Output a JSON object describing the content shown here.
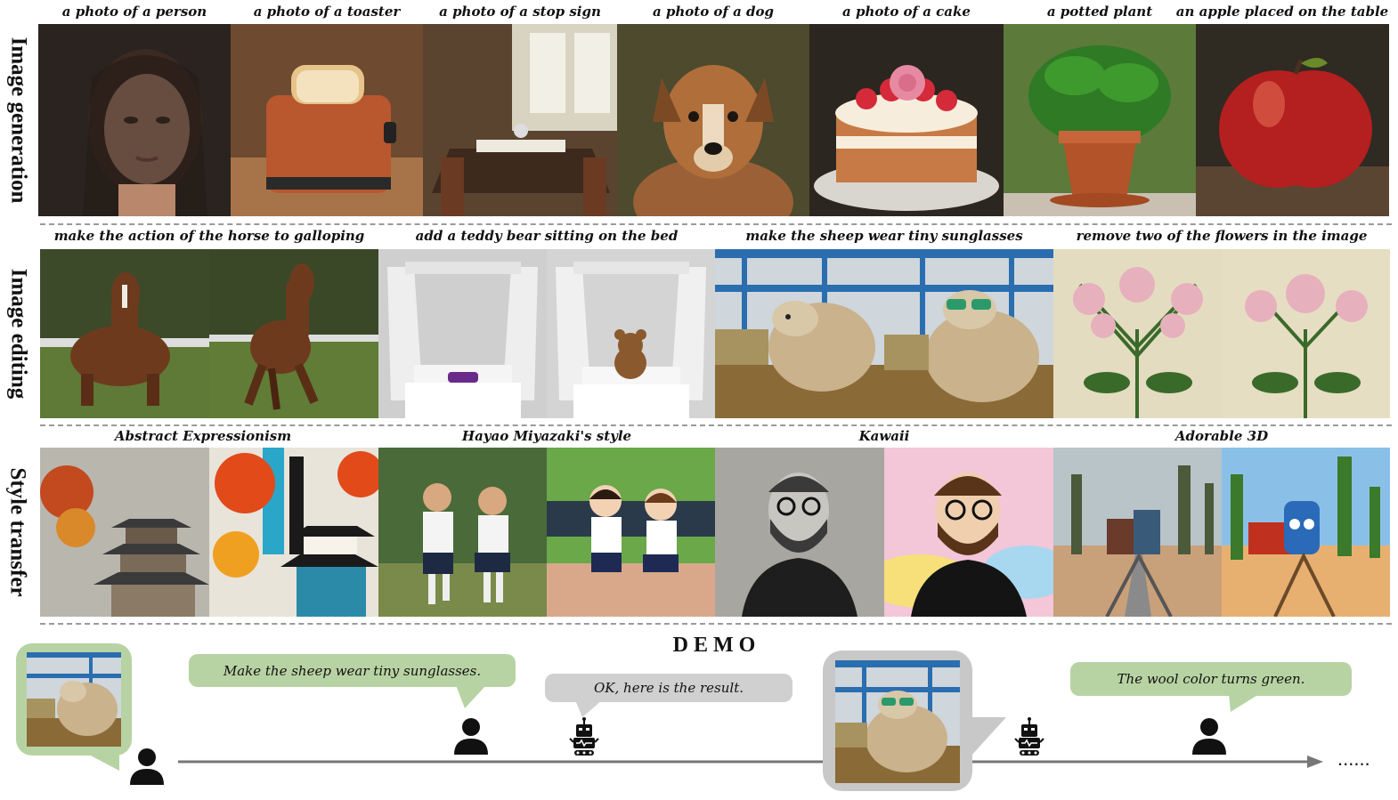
{
  "rows": {
    "generation_label": "Image generation",
    "editing_label": "Image editing",
    "style_label": "Style transfer"
  },
  "generation": {
    "captions": [
      "a photo of a person",
      "a photo of a toaster",
      "a photo of a stop sign",
      "a photo of a dog",
      "a photo of a cake",
      "a potted plant",
      "an apple placed on the table"
    ]
  },
  "editing": {
    "captions": [
      "make the action of the horse to galloping",
      "add a teddy bear sitting on the bed",
      "make the sheep wear tiny sunglasses",
      "remove two of the flowers in the image"
    ]
  },
  "style": {
    "captions": [
      "Abstract Expressionism",
      "Hayao Miyazaki's style",
      "Kawaii",
      "Adorable 3D"
    ]
  },
  "demo": {
    "title": "DEMO",
    "user_msg_1": "Make the sheep wear tiny sunglasses.",
    "bot_msg_1": "OK, here is the result.",
    "user_msg_2": "The wool color turns green.",
    "ellipsis": "......"
  },
  "colors": {
    "green_bubble": "#b8d3a3",
    "gray_bubble": "#d0d0d0",
    "timeline": "#777777"
  },
  "icons": {
    "user": "person-icon",
    "bot": "robot-icon"
  }
}
